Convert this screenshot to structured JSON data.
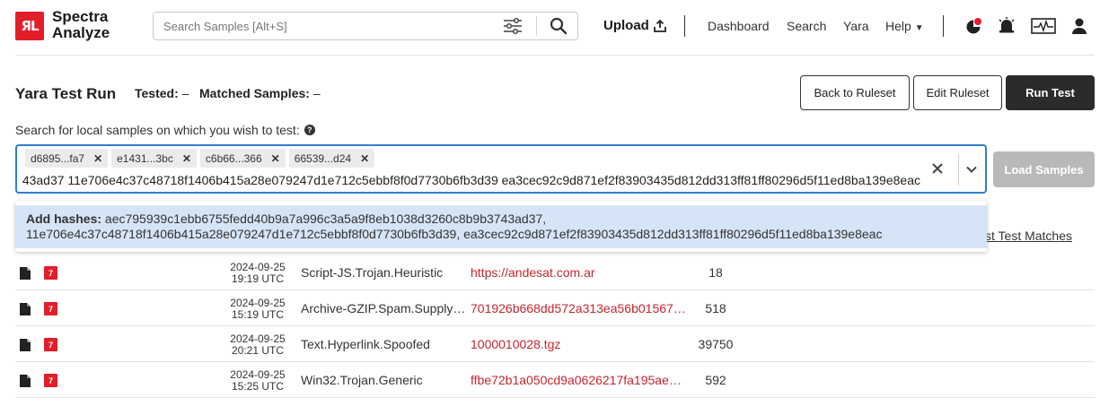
{
  "header": {
    "logo_mark": "ЯL",
    "logo_line1": "Spectra",
    "logo_line2": "Analyze",
    "search_placeholder": "Search Samples [Alt+S]",
    "upload_label": "Upload",
    "nav": [
      "Dashboard",
      "Search",
      "Yara",
      "Help"
    ],
    "icons": [
      "filter-sliders-icon",
      "search-icon",
      "upload-icon",
      "pie-chart-icon",
      "alarm-bell-icon",
      "heartbeat-monitor-icon",
      "user-icon"
    ]
  },
  "page": {
    "title": "Yara Test Run",
    "tested_label": "Tested:",
    "tested_value": "–",
    "matched_label": "Matched Samples:",
    "matched_value": "–",
    "buttons": {
      "back": "Back to Ruleset",
      "edit": "Edit Ruleset",
      "run": "Run Test"
    },
    "search_label": "Search for local samples on which you wish to test:",
    "load_button": "Load Samples"
  },
  "multiselect": {
    "chips": [
      "d6895...fa7",
      "e1431...3bc",
      "c6b66...366",
      "66539...d24"
    ],
    "typed_text": "aec795939c1ebb6755fedd40b9a7a996c3a5a9f8eb1038d3260c8b9b3743ad37 11e706e4c37c48718f1406b415a28e079247d1e712c5ebbf8f0d7730b6fb3d39 ea3cec92c9d871ef2f83903435d812dd313ff81ff80296d5f11ed8ba139e8eac"
  },
  "dropdown": {
    "prefix": "Add hashes:",
    "line1": "aec795939c1ebb6755fedd40b9a7a996c3a5a9f8eb1038d3260c8b9b3743ad37,",
    "line2": "11e706e4c37c48718f1406b415a28e079247d1e712c5ebbf8f0d7730b6fb3d39, ea3cec92c9d871ef2f83903435d812dd313ff81ff80296d5f11ed8ba139e8eac",
    "behind_link": "st Test Matches"
  },
  "table": {
    "rows": [
      {
        "badge": "7",
        "date": "2024-09-25",
        "time": "19:19 UTC",
        "threat": "Script-JS.Trojan.Heuristic",
        "file": "https://andesat.com.ar",
        "size": "18"
      },
      {
        "badge": "7",
        "date": "2024-09-25",
        "time": "15:19 UTC",
        "threat": "Archive-GZIP.Spam.Supply…",
        "file": "701926b668dd572a313ea56b01567…",
        "size": "518"
      },
      {
        "badge": "7",
        "date": "2024-09-25",
        "time": "20:21 UTC",
        "threat": "Text.Hyperlink.Spoofed",
        "file": "1000010028.tgz",
        "size": "39750"
      },
      {
        "badge": "7",
        "date": "2024-09-25",
        "time": "15:25 UTC",
        "threat": "Win32.Trojan.Generic",
        "file": "ffbe72b1a050cd9a0626217fa195ae…",
        "size": "592"
      }
    ]
  },
  "colors": {
    "brand_red": "#e31e2b",
    "focus_blue": "#2d7fd0",
    "dropdown_highlight": "#d6e4f7",
    "link_red": "#c4262e",
    "dark_button": "#2b2b2b",
    "disabled_button": "#b9b9b9"
  }
}
